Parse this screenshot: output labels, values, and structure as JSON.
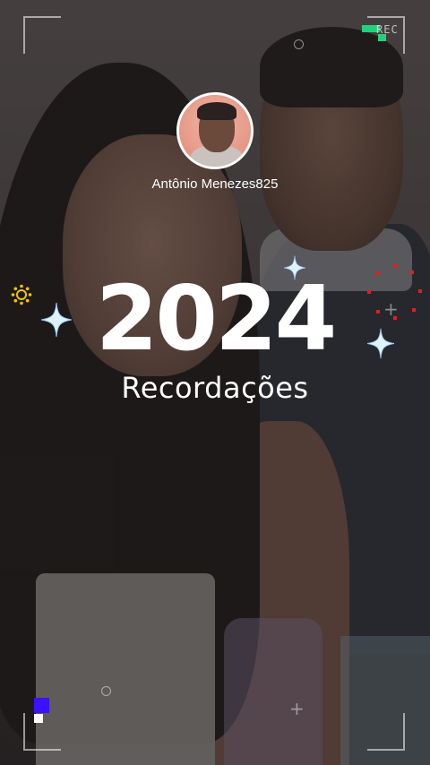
{
  "profile": {
    "username": "Antônio Menezes825"
  },
  "title": {
    "year": "2024",
    "subtitle": "Recordações"
  },
  "overlay": {
    "rec_label": "REC"
  },
  "colors": {
    "rec_indicator": "#25d07a",
    "accent_blue": "#3b12ff",
    "sun_icon": "#f2c400",
    "dots_icon": "#e0201c",
    "sparkle": "#dff3ff"
  },
  "icons": [
    "sparkle-icon",
    "sun-icon",
    "red-dots-ring-icon",
    "camera-crosshair-icon"
  ]
}
